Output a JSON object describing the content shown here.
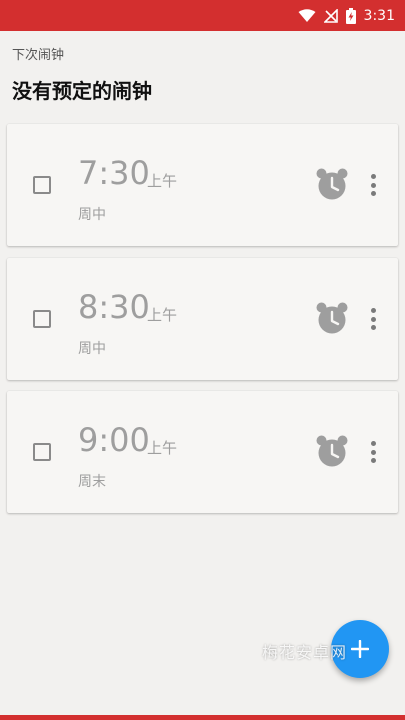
{
  "status_bar": {
    "time": "3:31"
  },
  "header": {
    "subtitle": "下次闹钟",
    "title": "没有预定的闹钟"
  },
  "alarms": [
    {
      "time": "7:30",
      "ampm": "上午",
      "repeat": "周中",
      "enabled": false
    },
    {
      "time": "8:30",
      "ampm": "上午",
      "repeat": "周中",
      "enabled": false
    },
    {
      "time": "9:00",
      "ampm": "上午",
      "repeat": "周末",
      "enabled": false
    }
  ],
  "watermark": "梅花安卓网",
  "icons": {
    "wifi": "wifi-icon",
    "signal": "no-signal-icon",
    "battery": "battery-charging-icon",
    "alarm": "alarm-clock-icon",
    "more": "more-vert-icon",
    "add": "plus-icon"
  },
  "colors": {
    "accent": "#d32f2f",
    "fab": "#2196f3",
    "text_muted": "#9e9e9e"
  }
}
